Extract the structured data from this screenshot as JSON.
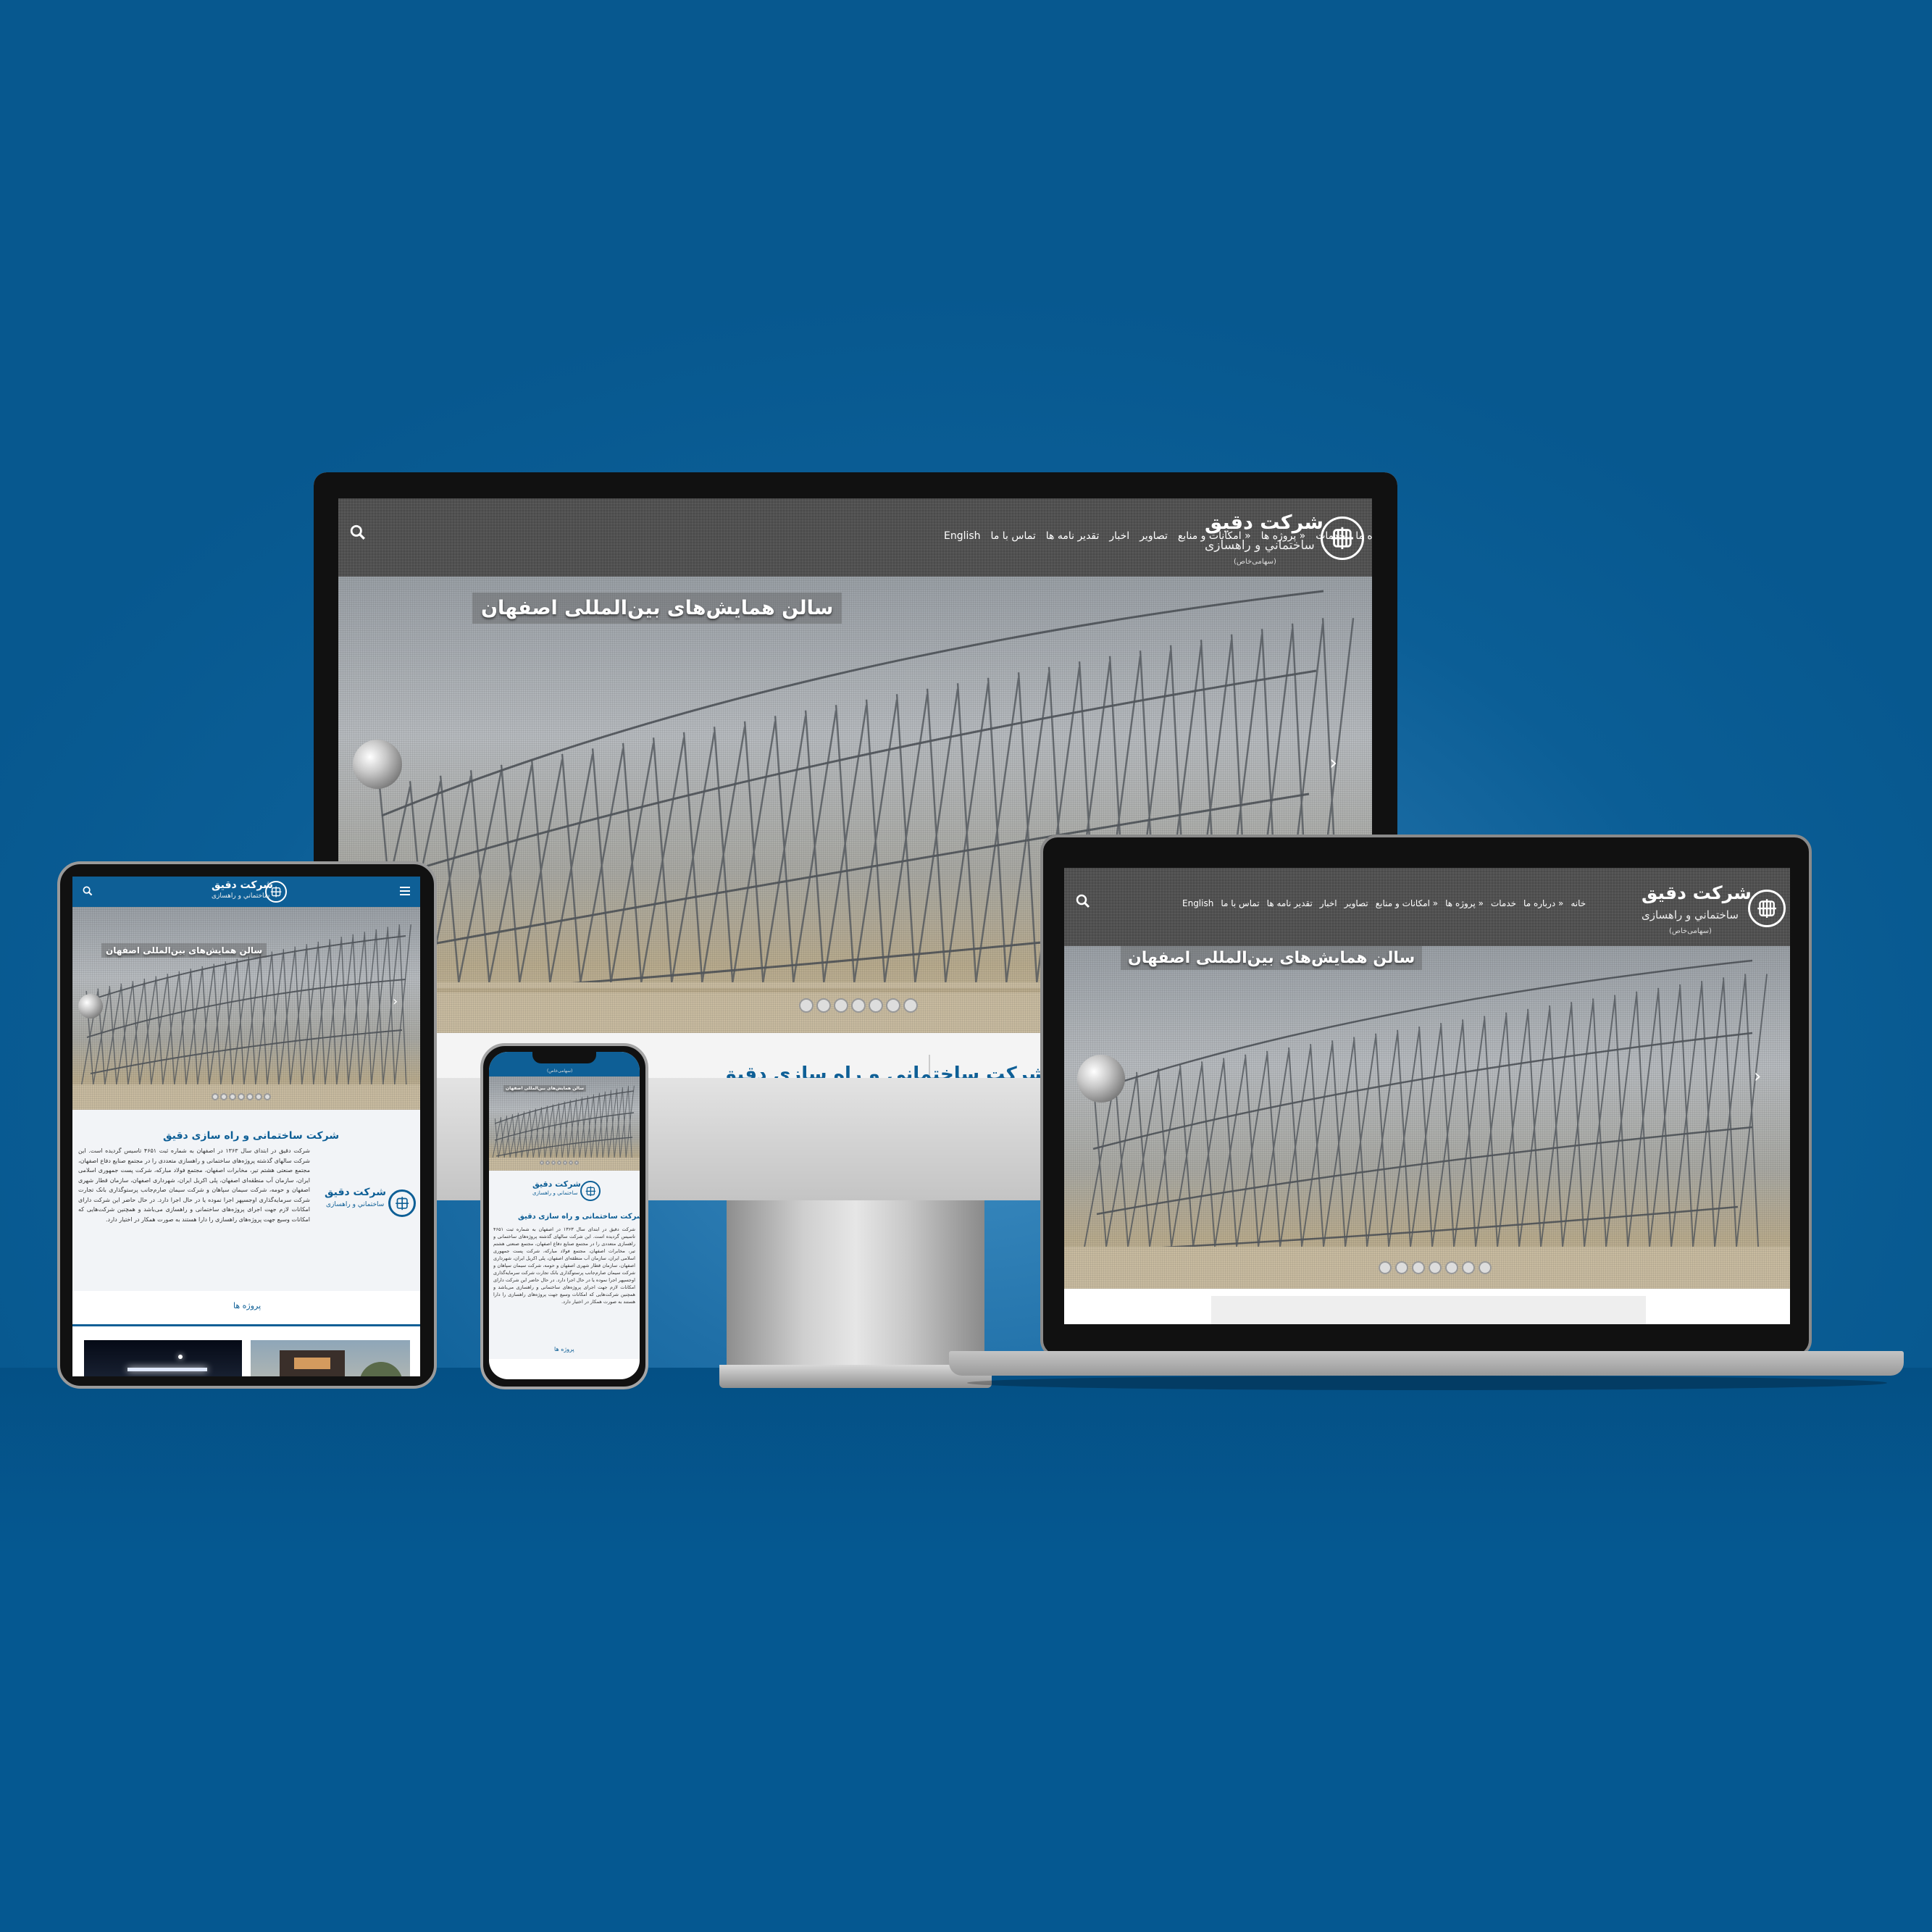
{
  "site": {
    "brand_name": "شرکت دقیق",
    "brand_sub": "ساختماني و راهسازی",
    "brand_tiny": "(سهامی‌خاص)",
    "nav": [
      "خانه",
      "درباره ما »",
      "خدمات",
      "پروژه ها »",
      "امکانات و منابع »",
      "تصاویر",
      "اخبار",
      "تقدیر نامه ها",
      "تماس با ما",
      "English"
    ],
    "hero_caption": "سالن همایش‌های بین‌المللی اصفهان",
    "slider_dots": 7,
    "section_title": "شرکت ساختمانی و راه سازی دقیق",
    "section_title_partial": "شرکت ساختمانی و راه سازی دقیق",
    "about_text": "شرکت دقیق در ابتدای سال ۱۳۶۳ در اصفهان به شماره ثبت ۴۶۵۱ تاسیس گردیده است. این شرکت سالهای گذشته پروژه‌های ساختمانی و راهسازی متعددی را در مجتمع صنایع دفاع اصفهان، مجتمع صنعتی هشتم تیر، مخابرات اصفهان، مجتمع فولاد مبارکه، شرکت پست جمهوری اسلامی ایران، سازمان آب منطقه‌ای اصفهان، پلی اکریل ایران، شهرداری اصفهان، سازمان قطار شهری اصفهان و حومه، شرکت سیمان سپاهان و شرکت سیمان صارم‌جانب پرستوگذاری بانک تجارت شرکت سرمایه‌گذاری اوجسپهر اجرا نموده یا در حال اجرا دارد. در حال حاضر این شرکت دارای امکانات لازم جهت اجرای پروژه‌های ساختمانی و راهسازی می‌باشد و همچنین شرکت‌هایی که امکانات وسیع جهت پروژه‌های راهسازی را دارا هستند به صورت همکار در اختیار دارد.",
    "projects_label": "پروژه ها"
  },
  "colors": {
    "background": "#0b5e96",
    "header_gray": "#4a4a4a",
    "brand_blue": "#0e5f96",
    "device_frame": "#111111",
    "stand_silver": "#b9b9b9"
  },
  "icons": {
    "search": "search-icon",
    "menu": "hamburger-menu-icon",
    "logo": "company-logo-icon",
    "next": "chevron-right-icon"
  }
}
